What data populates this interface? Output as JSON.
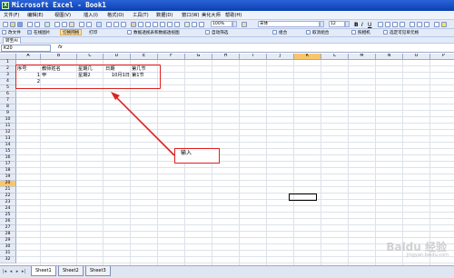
{
  "window": {
    "title": "Microsoft Excel - Book1",
    "app_icon": "excel-icon"
  },
  "menu": [
    "文件(F)",
    "编辑(E)",
    "视图(V)",
    "插入(I)",
    "格式(O)",
    "工具(T)",
    "数据(D)",
    "窗口(W)",
    "美化大师",
    "帮助(H)"
  ],
  "toolbar": {
    "zoom": "100%",
    "font_name": "宋体",
    "font_size": "12",
    "labels": [
      "打印",
      "保存",
      "复制",
      "粘贴"
    ],
    "row2": [
      "改文件",
      "在线图片",
      "切换网格",
      "打印",
      "数据透视表和数据透视图",
      "自动筛选",
      "组合",
      "取消组合",
      "照相机",
      "选定可见单元格"
    ],
    "row3_button": "转至AI"
  },
  "formula_bar": {
    "name_box": "K20",
    "fx": "fx",
    "value": ""
  },
  "columns": [
    "A",
    "B",
    "C",
    "D",
    "E",
    "F",
    "G",
    "H",
    "I",
    "J",
    "K",
    "L",
    "M",
    "N",
    "O",
    "P"
  ],
  "rows": [
    "1",
    "2",
    "3",
    "4",
    "5",
    "6",
    "7",
    "8",
    "9",
    "10",
    "11",
    "12",
    "13",
    "14",
    "15",
    "16",
    "17",
    "18",
    "19",
    "20",
    "21",
    "22",
    "23",
    "24",
    "25",
    "26",
    "27",
    "28",
    "29",
    "30",
    "31",
    "32"
  ],
  "active_cell": {
    "column": "K",
    "row": "20"
  },
  "cells": {
    "a2": "序号",
    "b2": "教师姓名",
    "c2": "星期几",
    "d2": "日期",
    "e2": "第几节",
    "a3": "1",
    "b3": "甲",
    "c3": "星期2",
    "d3": "10月1日",
    "e3": "第1节",
    "a4": "2"
  },
  "annotation": {
    "label": "输入",
    "color": "#e02020"
  },
  "sheets": {
    "tabs": [
      "Sheet1",
      "Sheet2",
      "Sheet3"
    ],
    "active": "Sheet1"
  },
  "watermark": {
    "text": "Baidu 经验",
    "sub": "jingyan.baidu.com"
  }
}
